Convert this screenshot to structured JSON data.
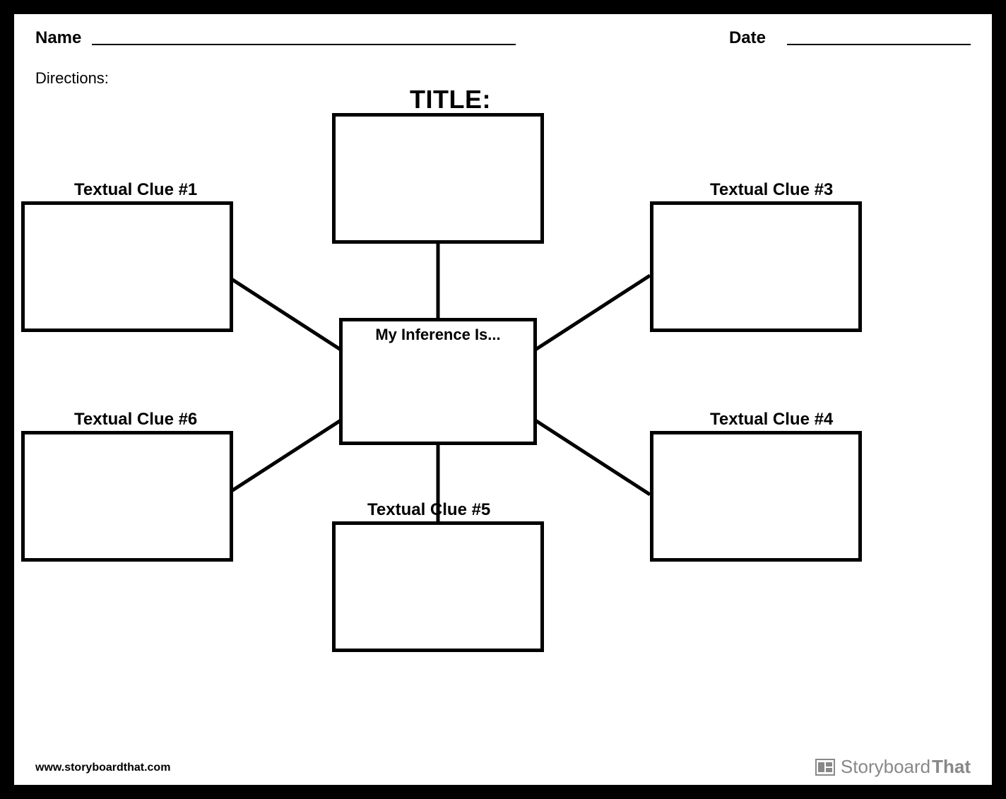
{
  "header": {
    "name_label": "Name",
    "date_label": "Date"
  },
  "directions_label": "Directions:",
  "title_label": "TITLE:",
  "center_label": "My Inference Is...",
  "clues": {
    "c1": "Textual Clue #1",
    "c3": "Textual Clue #3",
    "c4": "Textual Clue #4",
    "c5": "Textual Clue #5",
    "c6": "Textual Clue #6"
  },
  "footer": {
    "url": "www.storyboardthat.com",
    "brand1": "Storyboard",
    "brand2": "That"
  }
}
